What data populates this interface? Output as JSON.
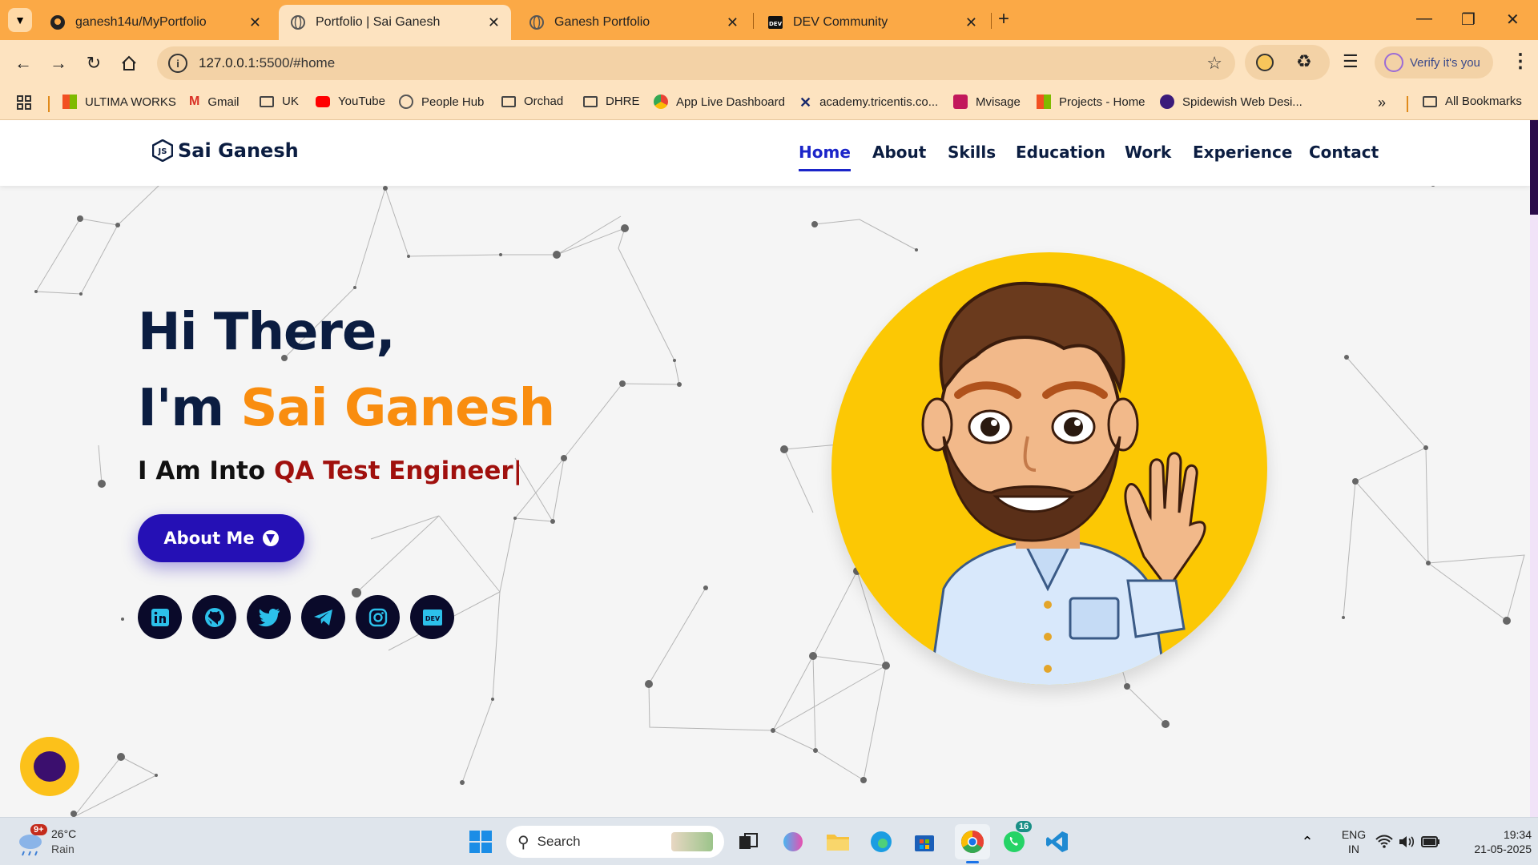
{
  "browser": {
    "tabs": [
      {
        "title": "ganesh14u/MyPortfolio",
        "icon": "github-icon"
      },
      {
        "title": "Portfolio | Sai Ganesh",
        "icon": "globe-icon",
        "active": true
      },
      {
        "title": "Ganesh Portfolio",
        "icon": "globe-icon"
      },
      {
        "title": "DEV Community",
        "icon": "dev-icon"
      }
    ],
    "url_host": "127.0.0.1",
    "url_rest": ":5500/#home",
    "verify_label": "Verify it's you",
    "bookmarks": [
      {
        "label": "ULTIMA WORKS",
        "icon": "windows-icon"
      },
      {
        "label": "Gmail",
        "icon": "gmail-icon"
      },
      {
        "label": "UK",
        "icon": "folder-icon"
      },
      {
        "label": "YouTube",
        "icon": "youtube-icon"
      },
      {
        "label": "People Hub",
        "icon": "globe-icon"
      },
      {
        "label": "Orchad",
        "icon": "folder-icon"
      },
      {
        "label": "DHRE",
        "icon": "folder-icon"
      },
      {
        "label": "App Live Dashboard",
        "icon": "chrome-icon"
      },
      {
        "label": "academy.tricentis.co...",
        "icon": "tricentis-icon"
      },
      {
        "label": "Mvisage",
        "icon": "mvisage-icon"
      },
      {
        "label": "Projects - Home",
        "icon": "windows-icon"
      },
      {
        "label": "Spidewish Web Desi...",
        "icon": "spidewish-icon"
      }
    ],
    "all_bookmarks_label": "All Bookmarks"
  },
  "site": {
    "logo_text": "Sai Ganesh",
    "nav": [
      "Home",
      "About",
      "Skills",
      "Education",
      "Work",
      "Experience",
      "Contact"
    ],
    "active_nav": "Home",
    "greeting": "Hi There,",
    "im": "I'm ",
    "name": "Sai Ganesh",
    "into_prefix": "I Am Into ",
    "role": "QA Test Engineer|",
    "about_button": "About Me",
    "socials": [
      "linkedin-icon",
      "github-icon",
      "twitter-icon",
      "telegram-icon",
      "instagram-icon",
      "dev-icon"
    ],
    "colors": {
      "navy": "#0b1d41",
      "orange": "#f98d0f",
      "accent": "#2510b5",
      "role_red": "#a0100d",
      "avatar_bg": "#fcc804"
    }
  },
  "taskbar": {
    "weather_temp": "26°C",
    "weather_desc": "Rain",
    "weather_badge": "9+",
    "search_placeholder": "Search",
    "whatsapp_badge": "16",
    "lang_top": "ENG",
    "lang_bottom": "IN",
    "time": "19:34",
    "date": "21-05-2025"
  }
}
